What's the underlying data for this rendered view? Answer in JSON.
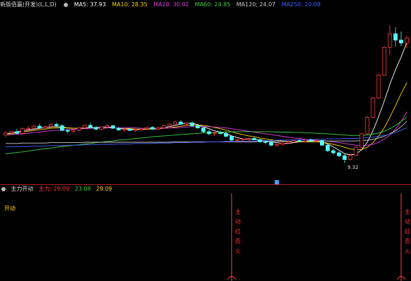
{
  "header": {
    "title": "新版佰赢(开发)(L,L,D)",
    "ma_items": [
      {
        "label": "MA5: 37.93",
        "color": "#ffffff"
      },
      {
        "label": "MA10: 28.35",
        "color": "#ffd400"
      },
      {
        "label": "MA20: 30.02",
        "color": "#e040e0"
      },
      {
        "label": "MA60: 24.85",
        "color": "#40d040"
      },
      {
        "label": "MA120: 24.07",
        "color": "#cccccc"
      },
      {
        "label": "MA250: 20.08",
        "color": "#4060ff"
      }
    ]
  },
  "sub_header": {
    "title": "主力开动",
    "items": [
      {
        "label": "主力: 29.09",
        "color": "#ff3030"
      },
      {
        "label": "23.08",
        "color": "#30d030"
      },
      {
        "label": "29.09",
        "color": "#ffd400"
      }
    ],
    "side_label": "开动",
    "signal_text": [
      "主",
      "动",
      "红",
      "而",
      "火"
    ]
  },
  "chart_data": {
    "type": "candlestick",
    "price_range": [
      5,
      45
    ],
    "low_annotation": "9.32",
    "candles": [
      [
        16,
        17,
        15.5,
        16.5
      ],
      [
        16.5,
        17.2,
        16,
        16.8
      ],
      [
        16.8,
        17.5,
        16.2,
        16.4
      ],
      [
        16.4,
        17.8,
        16.2,
        17.5
      ],
      [
        17.5,
        18.2,
        17,
        17.6
      ],
      [
        17.6,
        18.5,
        17.2,
        18.1
      ],
      [
        18.1,
        18.6,
        17.5,
        17.7
      ],
      [
        17.7,
        18.3,
        17.3,
        18
      ],
      [
        18,
        18.8,
        17.7,
        18.5
      ],
      [
        18.5,
        18.9,
        17.9,
        18.2
      ],
      [
        18.2,
        18.6,
        16.9,
        17.1
      ],
      [
        17.1,
        17.5,
        16.5,
        16.9
      ],
      [
        16.9,
        17.4,
        16.5,
        17.2
      ],
      [
        17.2,
        17.9,
        16.8,
        17.7
      ],
      [
        17.7,
        18.6,
        17.5,
        18.3
      ],
      [
        18.3,
        18.9,
        17.6,
        17.8
      ],
      [
        17.8,
        18.1,
        17.2,
        17.4
      ],
      [
        17.4,
        18,
        17.1,
        17.9
      ],
      [
        17.9,
        18.5,
        17.6,
        18.2
      ],
      [
        18.2,
        18.4,
        17.5,
        17.6
      ],
      [
        17.6,
        17.9,
        17,
        17.2
      ],
      [
        17.2,
        17.6,
        16.8,
        17.4
      ],
      [
        17.4,
        17.8,
        17,
        17.1
      ],
      [
        17.1,
        17.5,
        16.8,
        17.3
      ],
      [
        17.3,
        17.7,
        17,
        17.5
      ],
      [
        17.5,
        18,
        17.2,
        17.8
      ],
      [
        17.8,
        18.1,
        17.3,
        17.4
      ],
      [
        17.4,
        17.9,
        17.1,
        17.7
      ],
      [
        17.7,
        18.4,
        17.5,
        18.2
      ],
      [
        18.2,
        18.8,
        17.9,
        18.6
      ],
      [
        18.6,
        19.4,
        18.3,
        19.1
      ],
      [
        19.1,
        19.5,
        18.4,
        18.6
      ],
      [
        18.6,
        19,
        18.2,
        18.9
      ],
      [
        18.9,
        19.2,
        18,
        18.2
      ],
      [
        18.2,
        18.6,
        17.5,
        17.7
      ],
      [
        17.7,
        18,
        16.5,
        16.8
      ],
      [
        16.8,
        17.2,
        16,
        16.3
      ],
      [
        16.3,
        16.8,
        15.8,
        16.5
      ],
      [
        16.5,
        17,
        16.2,
        16.4
      ],
      [
        16.4,
        16.9,
        15.5,
        15.7
      ],
      [
        15.7,
        16,
        14.6,
        14.8
      ],
      [
        14.8,
        15.2,
        14.2,
        14.9
      ],
      [
        14.9,
        15.3,
        14.5,
        15.1
      ],
      [
        15.1,
        15.4,
        14.7,
        15.2
      ],
      [
        15.2,
        15.6,
        14.8,
        14.9
      ],
      [
        14.9,
        15.1,
        14.2,
        14.4
      ],
      [
        14.4,
        14.8,
        13.9,
        14.3
      ],
      [
        14.3,
        14.6,
        13.4,
        13.6
      ],
      [
        13.6,
        14,
        13.2,
        13.8
      ],
      [
        13.8,
        14.3,
        13.5,
        14.1
      ],
      [
        14.1,
        14.6,
        13.9,
        14.4
      ],
      [
        14.4,
        14.9,
        14.1,
        14.7
      ],
      [
        14.7,
        15,
        14.3,
        14.5
      ],
      [
        14.5,
        14.9,
        14.2,
        14.8
      ],
      [
        14.8,
        15.2,
        14.4,
        14.6
      ],
      [
        14.6,
        15,
        14.3,
        14.7
      ],
      [
        14.7,
        14.9,
        13.4,
        13.6
      ],
      [
        13.6,
        13.9,
        12,
        12.3
      ],
      [
        12.3,
        12.8,
        11.4,
        11.8
      ],
      [
        11.8,
        12.2,
        10.8,
        11.1
      ],
      [
        11.1,
        11.6,
        9.32,
        10.2
      ],
      [
        10.2,
        11.4,
        10,
        11.2
      ],
      [
        11.2,
        13.4,
        11,
        13.1
      ],
      [
        13.1,
        16.5,
        13,
        16.3
      ],
      [
        16.3,
        20.5,
        16,
        20.2
      ],
      [
        20.2,
        25,
        20,
        24.8
      ],
      [
        24.8,
        30.5,
        24.5,
        30.2
      ],
      [
        30.2,
        37,
        30,
        36.8
      ],
      [
        36.8,
        42,
        35,
        40
      ],
      [
        40,
        41.5,
        37,
        38.5
      ],
      [
        38.5,
        40.5,
        37,
        37.8
      ],
      [
        37.8,
        39.5,
        36.5,
        39
      ]
    ],
    "lines": [
      {
        "name": "MA5",
        "color": "#ffffff",
        "values": [
          16.3,
          16.5,
          16.8,
          17,
          17.2,
          17.4,
          17.6,
          17.8,
          17.9,
          18,
          17.9,
          17.7,
          17.6,
          17.6,
          17.7,
          17.8,
          17.8,
          17.9,
          17.9,
          17.8,
          17.6,
          17.4,
          17.3,
          17.3,
          17.3,
          17.4,
          17.5,
          17.6,
          17.8,
          18,
          18.3,
          18.6,
          18.8,
          18.8,
          18.5,
          18,
          17.5,
          17,
          16.7,
          16.3,
          15.8,
          15.4,
          15.1,
          15,
          15,
          14.9,
          14.7,
          14.4,
          14.2,
          14,
          14,
          14.2,
          14.4,
          14.6,
          14.7,
          14.7,
          14.4,
          13.9,
          13.2,
          12.4,
          11.6,
          11.3,
          11.5,
          12.5,
          14.3,
          17,
          20.3,
          24,
          28,
          31.5,
          34.5,
          37.9
        ]
      },
      {
        "name": "MA10",
        "color": "#ffd400",
        "values": [
          16.2,
          16.3,
          16.5,
          16.7,
          16.9,
          17.1,
          17.3,
          17.4,
          17.6,
          17.7,
          17.7,
          17.7,
          17.6,
          17.6,
          17.6,
          17.6,
          17.6,
          17.6,
          17.7,
          17.7,
          17.7,
          17.6,
          17.5,
          17.4,
          17.4,
          17.4,
          17.4,
          17.5,
          17.6,
          17.7,
          17.9,
          18.1,
          18.3,
          18.4,
          18.4,
          18.3,
          18.1,
          17.8,
          17.5,
          17.2,
          16.8,
          16.4,
          16.1,
          15.8,
          15.6,
          15.3,
          15.1,
          14.9,
          14.7,
          14.6,
          14.5,
          14.4,
          14.4,
          14.4,
          14.4,
          14.4,
          14.3,
          14.1,
          13.8,
          13.5,
          13.1,
          12.7,
          12.5,
          12.6,
          13.1,
          14.2,
          15.7,
          17.7,
          20.2,
          23,
          25.8,
          28.4
        ]
      },
      {
        "name": "MA20",
        "color": "#e040e0",
        "values": [
          16,
          16.1,
          16.2,
          16.3,
          16.4,
          16.6,
          16.7,
          16.9,
          17,
          17.1,
          17.2,
          17.3,
          17.4,
          17.5,
          17.5,
          17.6,
          17.6,
          17.6,
          17.7,
          17.7,
          17.7,
          17.7,
          17.7,
          17.7,
          17.6,
          17.6,
          17.6,
          17.6,
          17.6,
          17.7,
          17.7,
          17.8,
          17.9,
          18,
          18,
          18,
          18,
          17.9,
          17.8,
          17.7,
          17.5,
          17.3,
          17.1,
          16.9,
          16.7,
          16.5,
          16.3,
          16.1,
          15.9,
          15.7,
          15.5,
          15.3,
          15.2,
          15,
          14.9,
          14.8,
          14.7,
          14.6,
          14.4,
          14.2,
          14,
          13.8,
          13.6,
          13.5,
          13.6,
          13.8,
          14.3,
          15,
          16,
          17.4,
          19.2,
          21.5
        ]
      },
      {
        "name": "MA60",
        "color": "#40d040",
        "values": [
          11.5,
          11.7,
          11.9,
          12,
          12.2,
          12.4,
          12.6,
          12.8,
          12.9,
          13.1,
          13.3,
          13.4,
          13.6,
          13.7,
          13.9,
          14,
          14.2,
          14.3,
          14.5,
          14.6,
          14.8,
          14.9,
          15,
          15.2,
          15.3,
          15.4,
          15.6,
          15.7,
          15.8,
          15.9,
          16,
          16.1,
          16.2,
          16.3,
          16.4,
          16.5,
          16.6,
          16.6,
          16.7,
          16.7,
          16.8,
          16.8,
          16.8,
          16.8,
          16.8,
          16.8,
          16.8,
          16.8,
          16.7,
          16.7,
          16.7,
          16.6,
          16.6,
          16.5,
          16.5,
          16.4,
          16.4,
          16.3,
          16.2,
          16.1,
          16,
          15.9,
          15.9,
          15.9,
          16,
          16.2,
          16.5,
          16.9,
          17.5,
          18.3,
          19.2,
          20.3
        ]
      },
      {
        "name": "MA120",
        "color": "#cccccc",
        "values": [
          14,
          14,
          14,
          14.1,
          14.1,
          14.1,
          14.1,
          14.1,
          14.2,
          14.2,
          14.2,
          14.2,
          14.2,
          14.2,
          14.3,
          14.3,
          14.3,
          14.3,
          14.3,
          14.3,
          14.3,
          14.3,
          14.3,
          14.3,
          14.3,
          14.3,
          14.3,
          14.3,
          14.3,
          14.3,
          14.4,
          14.4,
          14.4,
          14.4,
          14.4,
          14.4,
          14.4,
          14.4,
          14.4,
          14.4,
          14.4,
          14.4,
          14.4,
          14.4,
          14.4,
          14.5,
          14.5,
          14.5,
          14.5,
          14.5,
          14.5,
          14.5,
          14.5,
          14.5,
          14.5,
          14.5,
          14.6,
          14.6,
          14.6,
          14.6,
          14.6,
          14.6,
          14.6,
          14.7,
          14.8,
          15,
          15.3,
          15.7,
          16.3,
          17,
          18,
          19.2
        ]
      },
      {
        "name": "MA250",
        "color": "#4060ff",
        "values": [
          13.2,
          13.2,
          13.3,
          13.3,
          13.3,
          13.4,
          13.4,
          13.4,
          13.5,
          13.5,
          13.5,
          13.6,
          13.6,
          13.6,
          13.7,
          13.7,
          13.7,
          13.8,
          13.8,
          13.8,
          13.9,
          13.9,
          13.9,
          14,
          14,
          14,
          14,
          14.1,
          14.1,
          14.1,
          14.2,
          14.2,
          14.2,
          14.3,
          14.3,
          14.3,
          14.4,
          14.4,
          14.4,
          14.5,
          14.5,
          14.5,
          14.6,
          14.6,
          14.6,
          14.7,
          14.7,
          14.7,
          14.8,
          14.8,
          14.8,
          14.9,
          14.9,
          14.9,
          15,
          15,
          15,
          15.1,
          15.1,
          15.1,
          15.2,
          15.2,
          15.2,
          15.3,
          15.4,
          15.5,
          15.7,
          15.9,
          16.2,
          16.6,
          17.1,
          17.8
        ]
      }
    ],
    "signals": [
      {
        "candle_index": 48,
        "color": "#4aa0ff"
      }
    ],
    "sub_signals": [
      {
        "candle_index": 40
      },
      {
        "candle_index": 70
      }
    ]
  }
}
